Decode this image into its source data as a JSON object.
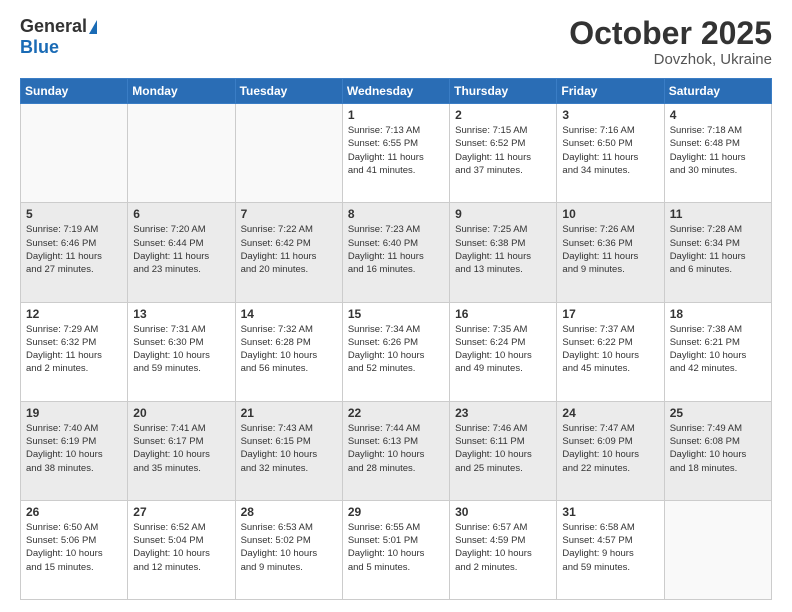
{
  "header": {
    "logo": {
      "general": "General",
      "blue": "Blue"
    },
    "title": "October 2025",
    "location": "Dovzhok, Ukraine"
  },
  "weekdays": [
    "Sunday",
    "Monday",
    "Tuesday",
    "Wednesday",
    "Thursday",
    "Friday",
    "Saturday"
  ],
  "rows": [
    [
      {
        "day": "",
        "info": ""
      },
      {
        "day": "",
        "info": ""
      },
      {
        "day": "",
        "info": ""
      },
      {
        "day": "1",
        "info": "Sunrise: 7:13 AM\nSunset: 6:55 PM\nDaylight: 11 hours\nand 41 minutes."
      },
      {
        "day": "2",
        "info": "Sunrise: 7:15 AM\nSunset: 6:52 PM\nDaylight: 11 hours\nand 37 minutes."
      },
      {
        "day": "3",
        "info": "Sunrise: 7:16 AM\nSunset: 6:50 PM\nDaylight: 11 hours\nand 34 minutes."
      },
      {
        "day": "4",
        "info": "Sunrise: 7:18 AM\nSunset: 6:48 PM\nDaylight: 11 hours\nand 30 minutes."
      }
    ],
    [
      {
        "day": "5",
        "info": "Sunrise: 7:19 AM\nSunset: 6:46 PM\nDaylight: 11 hours\nand 27 minutes."
      },
      {
        "day": "6",
        "info": "Sunrise: 7:20 AM\nSunset: 6:44 PM\nDaylight: 11 hours\nand 23 minutes."
      },
      {
        "day": "7",
        "info": "Sunrise: 7:22 AM\nSunset: 6:42 PM\nDaylight: 11 hours\nand 20 minutes."
      },
      {
        "day": "8",
        "info": "Sunrise: 7:23 AM\nSunset: 6:40 PM\nDaylight: 11 hours\nand 16 minutes."
      },
      {
        "day": "9",
        "info": "Sunrise: 7:25 AM\nSunset: 6:38 PM\nDaylight: 11 hours\nand 13 minutes."
      },
      {
        "day": "10",
        "info": "Sunrise: 7:26 AM\nSunset: 6:36 PM\nDaylight: 11 hours\nand 9 minutes."
      },
      {
        "day": "11",
        "info": "Sunrise: 7:28 AM\nSunset: 6:34 PM\nDaylight: 11 hours\nand 6 minutes."
      }
    ],
    [
      {
        "day": "12",
        "info": "Sunrise: 7:29 AM\nSunset: 6:32 PM\nDaylight: 11 hours\nand 2 minutes."
      },
      {
        "day": "13",
        "info": "Sunrise: 7:31 AM\nSunset: 6:30 PM\nDaylight: 10 hours\nand 59 minutes."
      },
      {
        "day": "14",
        "info": "Sunrise: 7:32 AM\nSunset: 6:28 PM\nDaylight: 10 hours\nand 56 minutes."
      },
      {
        "day": "15",
        "info": "Sunrise: 7:34 AM\nSunset: 6:26 PM\nDaylight: 10 hours\nand 52 minutes."
      },
      {
        "day": "16",
        "info": "Sunrise: 7:35 AM\nSunset: 6:24 PM\nDaylight: 10 hours\nand 49 minutes."
      },
      {
        "day": "17",
        "info": "Sunrise: 7:37 AM\nSunset: 6:22 PM\nDaylight: 10 hours\nand 45 minutes."
      },
      {
        "day": "18",
        "info": "Sunrise: 7:38 AM\nSunset: 6:21 PM\nDaylight: 10 hours\nand 42 minutes."
      }
    ],
    [
      {
        "day": "19",
        "info": "Sunrise: 7:40 AM\nSunset: 6:19 PM\nDaylight: 10 hours\nand 38 minutes."
      },
      {
        "day": "20",
        "info": "Sunrise: 7:41 AM\nSunset: 6:17 PM\nDaylight: 10 hours\nand 35 minutes."
      },
      {
        "day": "21",
        "info": "Sunrise: 7:43 AM\nSunset: 6:15 PM\nDaylight: 10 hours\nand 32 minutes."
      },
      {
        "day": "22",
        "info": "Sunrise: 7:44 AM\nSunset: 6:13 PM\nDaylight: 10 hours\nand 28 minutes."
      },
      {
        "day": "23",
        "info": "Sunrise: 7:46 AM\nSunset: 6:11 PM\nDaylight: 10 hours\nand 25 minutes."
      },
      {
        "day": "24",
        "info": "Sunrise: 7:47 AM\nSunset: 6:09 PM\nDaylight: 10 hours\nand 22 minutes."
      },
      {
        "day": "25",
        "info": "Sunrise: 7:49 AM\nSunset: 6:08 PM\nDaylight: 10 hours\nand 18 minutes."
      }
    ],
    [
      {
        "day": "26",
        "info": "Sunrise: 6:50 AM\nSunset: 5:06 PM\nDaylight: 10 hours\nand 15 minutes."
      },
      {
        "day": "27",
        "info": "Sunrise: 6:52 AM\nSunset: 5:04 PM\nDaylight: 10 hours\nand 12 minutes."
      },
      {
        "day": "28",
        "info": "Sunrise: 6:53 AM\nSunset: 5:02 PM\nDaylight: 10 hours\nand 9 minutes."
      },
      {
        "day": "29",
        "info": "Sunrise: 6:55 AM\nSunset: 5:01 PM\nDaylight: 10 hours\nand 5 minutes."
      },
      {
        "day": "30",
        "info": "Sunrise: 6:57 AM\nSunset: 4:59 PM\nDaylight: 10 hours\nand 2 minutes."
      },
      {
        "day": "31",
        "info": "Sunrise: 6:58 AM\nSunset: 4:57 PM\nDaylight: 9 hours\nand 59 minutes."
      },
      {
        "day": "",
        "info": ""
      }
    ]
  ]
}
